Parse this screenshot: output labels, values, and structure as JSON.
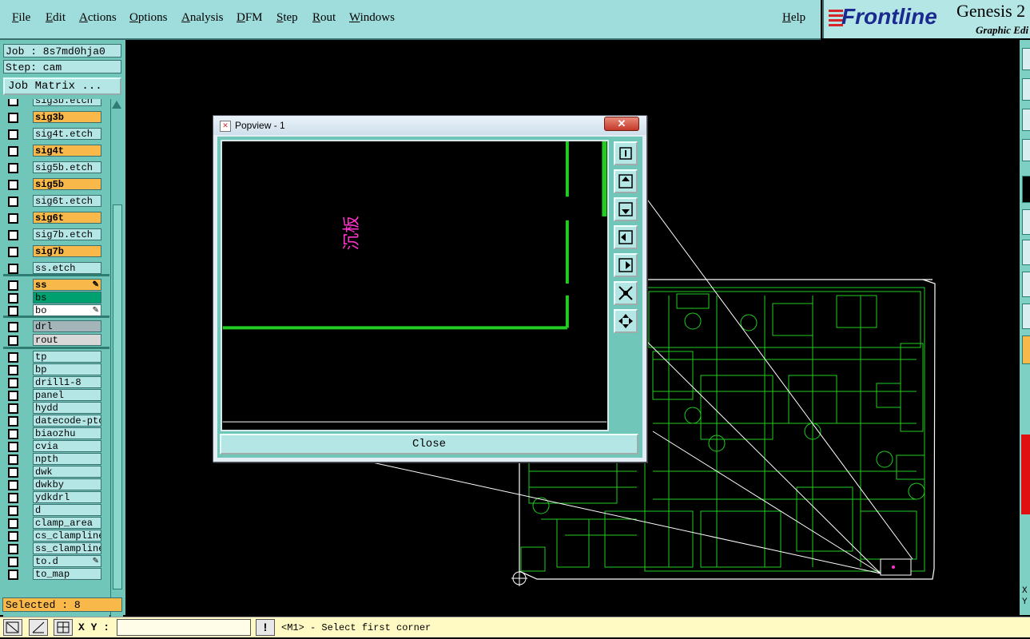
{
  "menubar": {
    "items": [
      "File",
      "Edit",
      "Actions",
      "Options",
      "Analysis",
      "DFM",
      "Step",
      "Rout",
      "Windows"
    ],
    "help": "Help"
  },
  "logo": {
    "brand": "Frontline",
    "product": "Genesis 2",
    "subtitle": "Graphic Edi"
  },
  "job": {
    "job_line": "Job : 8s7md0hja0",
    "step_line": "Step: cam",
    "matrix_button": "Job Matrix ..."
  },
  "layers": [
    {
      "name": "sig3b.etch",
      "color": "#b5e6e6"
    },
    {
      "name": "sig3b",
      "color": "#f8b94a"
    },
    {
      "name": "sig4t.etch",
      "color": "#b5e6e6"
    },
    {
      "name": "sig4t",
      "color": "#f8b94a"
    },
    {
      "name": "sig5b.etch",
      "color": "#b5e6e6"
    },
    {
      "name": "sig5b",
      "color": "#f8b94a"
    },
    {
      "name": "sig6t.etch",
      "color": "#b5e6e6"
    },
    {
      "name": "sig6t",
      "color": "#f8b94a"
    },
    {
      "name": "sig7b.etch",
      "color": "#b5e6e6"
    },
    {
      "name": "sig7b",
      "color": "#f8b94a"
    },
    {
      "name": "ss.etch",
      "color": "#b5e6e6"
    },
    {
      "name": "ss",
      "color": "#f8b94a",
      "mark": "pen"
    },
    {
      "name": "bs",
      "color": "#00a070"
    },
    {
      "name": "bo",
      "color": "#ffffff",
      "mark": "pen"
    },
    {
      "name": "drl",
      "color": "#a3b5b8"
    },
    {
      "name": "rout",
      "color": "#d8d8d8"
    },
    {
      "name": "tp",
      "color": "#b5e6e6"
    },
    {
      "name": "bp",
      "color": "#b5e6e6"
    },
    {
      "name": "drill1-8",
      "color": "#b5e6e6"
    },
    {
      "name": "panel",
      "color": "#b5e6e6"
    },
    {
      "name": "hydd",
      "color": "#b5e6e6"
    },
    {
      "name": "datecode-pto",
      "color": "#b5e6e6"
    },
    {
      "name": "biaozhu",
      "color": "#b5e6e6"
    },
    {
      "name": "cvia",
      "color": "#b5e6e6"
    },
    {
      "name": "npth",
      "color": "#b5e6e6"
    },
    {
      "name": "dwk",
      "color": "#b5e6e6"
    },
    {
      "name": "dwkby",
      "color": "#b5e6e6"
    },
    {
      "name": "ydkdrl",
      "color": "#b5e6e6"
    },
    {
      "name": "d",
      "color": "#b5e6e6"
    },
    {
      "name": "clamp_area",
      "color": "#b5e6e6"
    },
    {
      "name": "cs_clampline",
      "color": "#b5e6e6"
    },
    {
      "name": "ss_clampline",
      "color": "#b5e6e6"
    },
    {
      "name": "to.d",
      "color": "#b5e6e6",
      "mark": "pen"
    },
    {
      "name": "to_map",
      "color": "#b5e6e6"
    }
  ],
  "selected": "Selected : 8",
  "statusbar": {
    "xy_label": "X Y :",
    "message": "<M1> - Select first corner"
  },
  "popview": {
    "title": "Popview - 1",
    "close_label": "Close",
    "canvas_text": "沉板"
  },
  "right_labels": [
    "X",
    "Y"
  ],
  "colors": {
    "panel": "#6fc6b9",
    "menu": "#9fdcdc",
    "signal_layer": "#f8b94a",
    "pcb_lines": "#22cc22"
  }
}
